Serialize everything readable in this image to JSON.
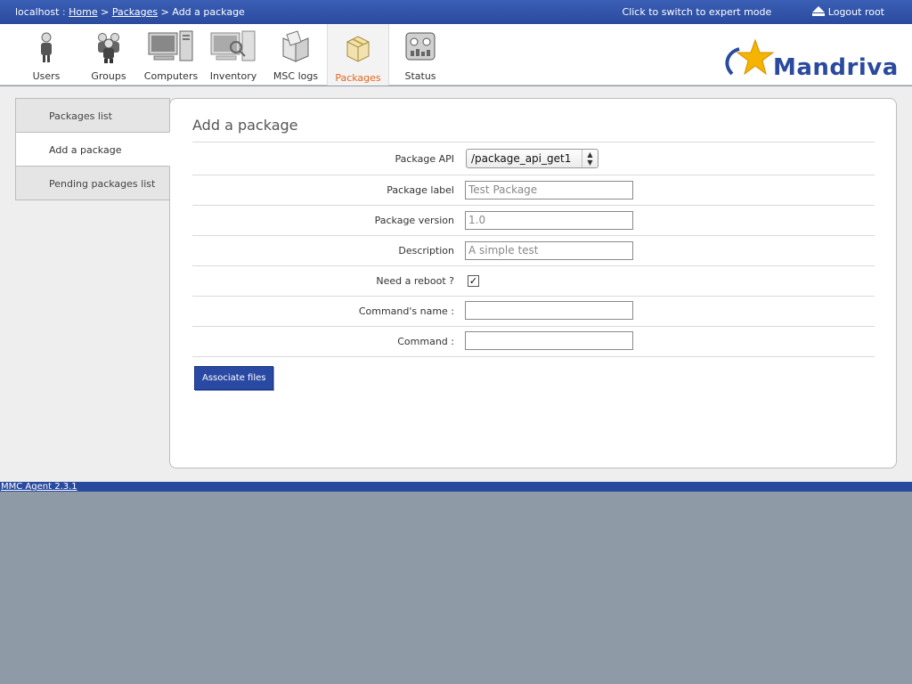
{
  "breadcrumb": {
    "host": "localhost",
    "separator1": ":",
    "home": "Home",
    "separator2": ">",
    "packages": "Packages",
    "separator3": ">",
    "current": "Add a package"
  },
  "topright": {
    "expert_mode": "Click to switch to expert mode",
    "logout": "Logout root"
  },
  "nav": {
    "items": [
      {
        "label": "Users",
        "icon": "users-icon"
      },
      {
        "label": "Groups",
        "icon": "groups-icon"
      },
      {
        "label": "Computers",
        "icon": "computers-icon"
      },
      {
        "label": "Inventory",
        "icon": "inventory-icon"
      },
      {
        "label": "MSC logs",
        "icon": "msc-logs-icon"
      },
      {
        "label": "Packages",
        "icon": "packages-icon",
        "active": true
      },
      {
        "label": "Status",
        "icon": "status-icon"
      }
    ]
  },
  "logo": {
    "text": "Mandriva"
  },
  "sidebar": {
    "items": [
      {
        "label": "Packages list"
      },
      {
        "label": "Add a package",
        "active": true
      },
      {
        "label": "Pending packages list"
      }
    ]
  },
  "form": {
    "title": "Add a package",
    "package_api": {
      "label": "Package API",
      "value": "/package_api_get1"
    },
    "package_label": {
      "label": "Package label",
      "placeholder": "Test Package"
    },
    "package_version": {
      "label": "Package version",
      "placeholder": "1.0"
    },
    "description": {
      "label": "Description",
      "placeholder": "A simple test"
    },
    "reboot": {
      "label": "Need a reboot ?",
      "checked": true
    },
    "command_name": {
      "label": "Command's name :",
      "value": ""
    },
    "command": {
      "label": "Command :",
      "value": ""
    },
    "associate_button": "Associate files"
  },
  "footer": {
    "version": "MMC Agent 2.3.1"
  },
  "colors": {
    "header": "#2a4a9e",
    "active_tab": "#e8661a",
    "button": "#2a49a3"
  }
}
